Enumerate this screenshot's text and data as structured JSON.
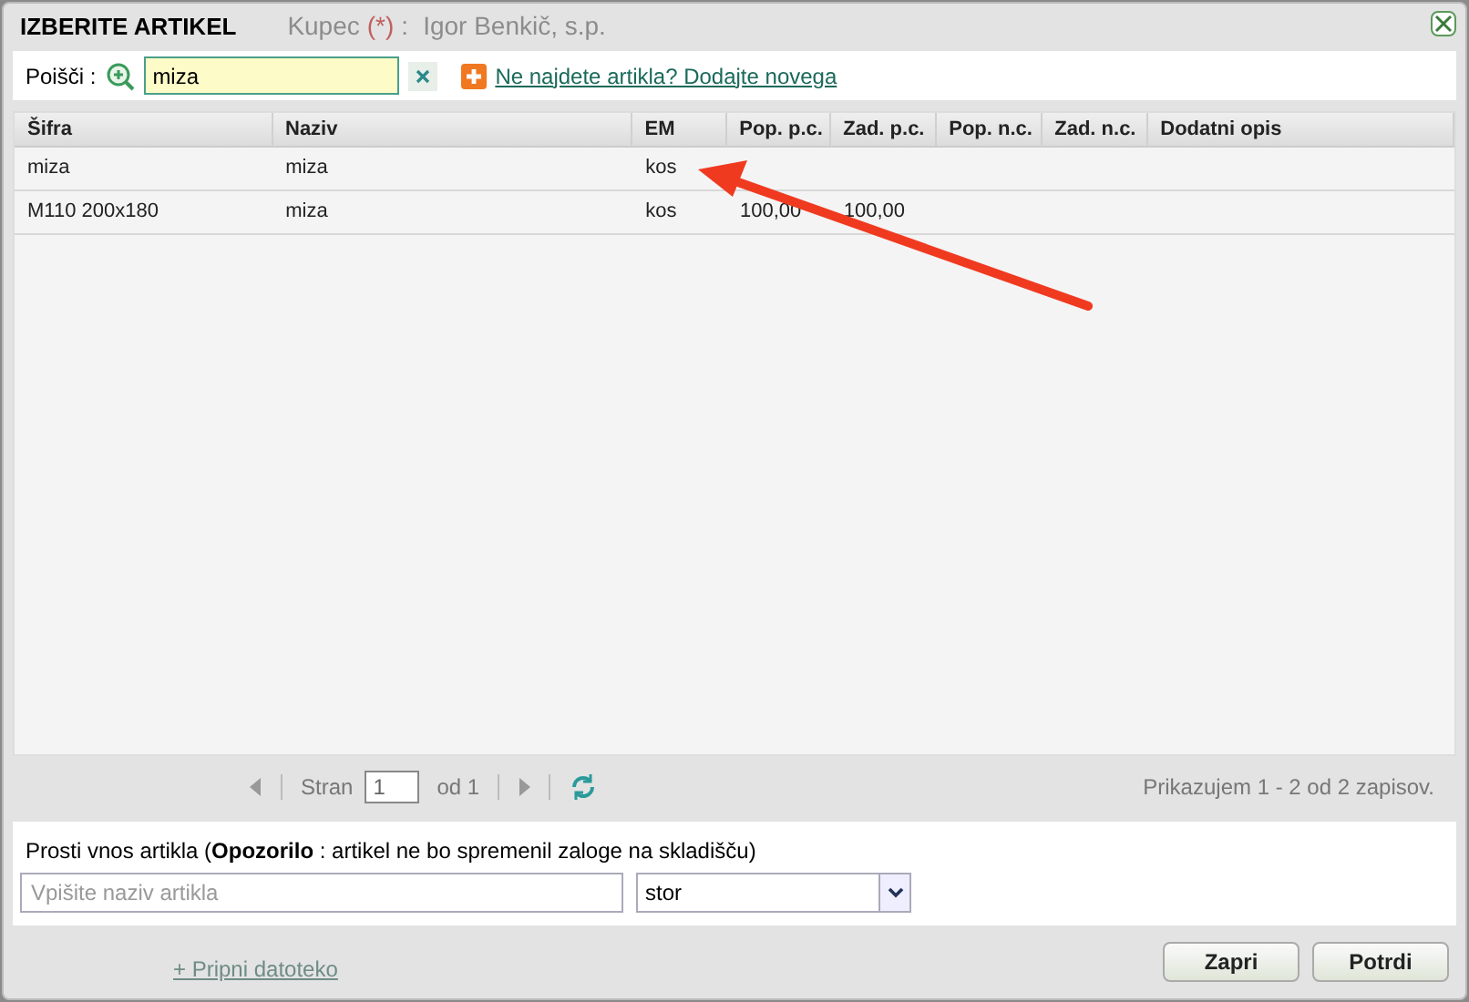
{
  "window": {
    "title": "IZBERITE ARTIKEL"
  },
  "background": {
    "customer_label": "Kupec",
    "required_mark": "(*)",
    "colon": ":",
    "customer_value": "Igor Benkič, s.p.",
    "attach_link": "+ Pripni datoteko"
  },
  "search": {
    "label": "Poišči :",
    "value": "miza",
    "add_link": "Ne najdete artikla? Dodajte novega"
  },
  "table": {
    "columns": [
      "Šifra",
      "Naziv",
      "EM",
      "Pop. p.c.",
      "Zad. p.c.",
      "Pop. n.c.",
      "Zad. n.c.",
      "Dodatni opis"
    ],
    "rows": [
      [
        "miza",
        "miza",
        "kos",
        "",
        "",
        "",
        "",
        ""
      ],
      [
        "M110 200x180",
        "miza",
        "kos",
        "100,00",
        "100,00",
        "",
        "",
        ""
      ]
    ]
  },
  "pager": {
    "page_label": "Stran",
    "page": "1",
    "of_label": "od 1",
    "summary": "Prikazujem 1 - 2 od 2 zapisov."
  },
  "free_entry": {
    "label": "Prosti vnos artikla (**Opozorilo** : artikel ne bo spremenil zaloge na skladišču)",
    "placeholder": "Vpišite naziv artikla",
    "unit": "stor"
  },
  "buttons": [
    "Zapri",
    "Potrdi"
  ]
}
